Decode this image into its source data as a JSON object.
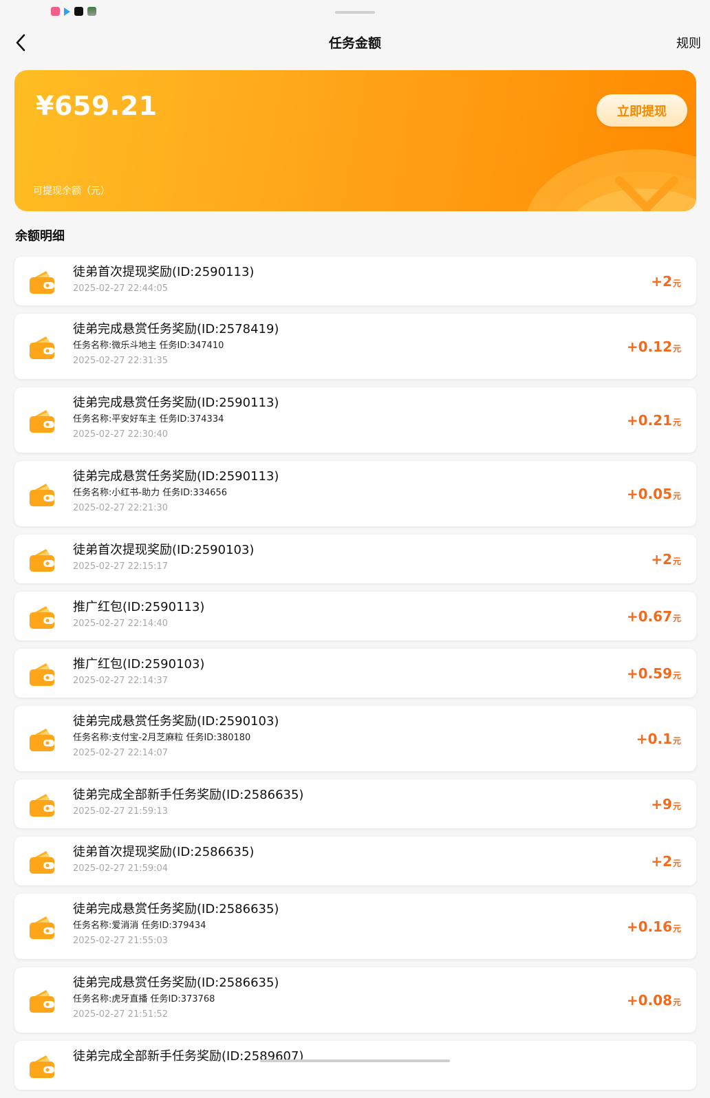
{
  "header": {
    "title": "任务金额",
    "rules_label": "规则"
  },
  "balance": {
    "amount": "¥659.21",
    "label": "可提现余额（元）",
    "withdraw_label": "立即提现"
  },
  "section_title": "余额明细",
  "unit": "元",
  "records": [
    {
      "title": "徒弟首次提现奖励(ID:2590113)",
      "sub": "",
      "time": "2025-02-27 22:44:05",
      "amount": "+2"
    },
    {
      "title": "徒弟完成悬赏任务奖励(ID:2578419)",
      "sub": "任务名称:微乐斗地主 任务ID:347410",
      "time": "2025-02-27 22:31:35",
      "amount": "+0.12"
    },
    {
      "title": "徒弟完成悬赏任务奖励(ID:2590113)",
      "sub": "任务名称:平安好车主 任务ID:374334",
      "time": "2025-02-27 22:30:40",
      "amount": "+0.21"
    },
    {
      "title": "徒弟完成悬赏任务奖励(ID:2590113)",
      "sub": "任务名称:小红书-助力 任务ID:334656",
      "time": "2025-02-27 22:21:30",
      "amount": "+0.05"
    },
    {
      "title": "徒弟首次提现奖励(ID:2590103)",
      "sub": "",
      "time": "2025-02-27 22:15:17",
      "amount": "+2"
    },
    {
      "title": "推广红包(ID:2590113)",
      "sub": "",
      "time": "2025-02-27 22:14:40",
      "amount": "+0.67"
    },
    {
      "title": "推广红包(ID:2590103)",
      "sub": "",
      "time": "2025-02-27 22:14:37",
      "amount": "+0.59"
    },
    {
      "title": "徒弟完成悬赏任务奖励(ID:2590103)",
      "sub": "任务名称:支付宝-2月芝麻粒 任务ID:380180",
      "time": "2025-02-27 22:14:07",
      "amount": "+0.1"
    },
    {
      "title": "徒弟完成全部新手任务奖励(ID:2586635)",
      "sub": "",
      "time": "2025-02-27 21:59:13",
      "amount": "+9"
    },
    {
      "title": "徒弟首次提现奖励(ID:2586635)",
      "sub": "",
      "time": "2025-02-27 21:59:04",
      "amount": "+2"
    },
    {
      "title": "徒弟完成悬赏任务奖励(ID:2586635)",
      "sub": "任务名称:爱消消 任务ID:379434",
      "time": "2025-02-27 21:55:03",
      "amount": "+0.16"
    },
    {
      "title": "徒弟完成悬赏任务奖励(ID:2586635)",
      "sub": "任务名称:虎牙直播 任务ID:373768",
      "time": "2025-02-27 21:51:52",
      "amount": "+0.08"
    },
    {
      "title": "徒弟完成全部新手任务奖励(ID:2589607)",
      "sub": "",
      "time": "",
      "amount": ""
    }
  ],
  "colors": {
    "accent": "#ffa51a",
    "amount": "#f26a1b",
    "withdraw_text": "#f08a00"
  }
}
